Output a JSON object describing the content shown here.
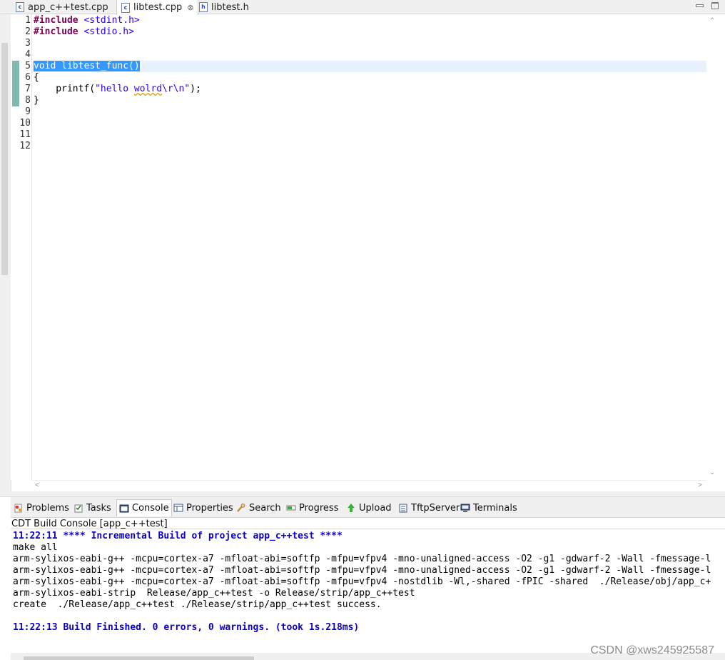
{
  "editor_tabs": [
    {
      "label": "app_c++test.cpp",
      "icon": "cpp-file-icon",
      "active": false
    },
    {
      "label": "libtest.cpp",
      "icon": "cpp-file-icon",
      "active": true,
      "close_glyph": "⊗"
    },
    {
      "label": "libtest.h",
      "icon": "header-file-icon",
      "active": false
    }
  ],
  "editor": {
    "line_numbers": [
      "1",
      "2",
      "3",
      "4",
      "5",
      "6",
      "7",
      "8",
      "9",
      "10",
      "11",
      "12"
    ],
    "lines": [
      {
        "n": 1,
        "kw": "#include",
        "rest": " <stdint.h>"
      },
      {
        "n": 2,
        "kw": "#include",
        "rest": " <stdio.h>"
      },
      {
        "n": 5,
        "selected": "void libtest_func()"
      },
      {
        "n": 6,
        "text": "{"
      },
      {
        "n": 7,
        "prefix": "    printf(",
        "str_a": "\"hello ",
        "str_b": "wolrd",
        "str_c": "\\r\\n\"",
        "suffix": ");"
      },
      {
        "n": 8,
        "text": "}"
      }
    ],
    "current_line": 5
  },
  "view_tabs": [
    {
      "label": "Problems",
      "icon": "problems-icon"
    },
    {
      "label": "Tasks",
      "icon": "tasks-icon"
    },
    {
      "label": "Console",
      "icon": "console-icon",
      "active": true
    },
    {
      "label": "Properties",
      "icon": "properties-icon"
    },
    {
      "label": "Search",
      "icon": "search-icon"
    },
    {
      "label": "Progress",
      "icon": "progress-icon"
    },
    {
      "label": "Upload",
      "icon": "upload-icon"
    },
    {
      "label": "TftpServer",
      "icon": "tftp-server-icon"
    },
    {
      "label": "Terminals",
      "icon": "terminals-icon"
    }
  ],
  "console": {
    "title": "CDT Build Console [app_c++test]",
    "lines": [
      {
        "text": "11:22:11 **** Incremental Build of project app_c++test ****",
        "style": "info"
      },
      {
        "text": "make all",
        "style": "normal"
      },
      {
        "text": "arm-sylixos-eabi-g++ -mcpu=cortex-a7 -mfloat-abi=softfp -mfpu=vfpv4 -mno-unaligned-access -O2 -g1 -gdwarf-2 -Wall -fmessage-l",
        "style": "normal"
      },
      {
        "text": "arm-sylixos-eabi-g++ -mcpu=cortex-a7 -mfloat-abi=softfp -mfpu=vfpv4 -mno-unaligned-access -O2 -g1 -gdwarf-2 -Wall -fmessage-l",
        "style": "normal"
      },
      {
        "text": "arm-sylixos-eabi-g++ -mcpu=cortex-a7 -mfloat-abi=softfp -mfpu=vfpv4 -nostdlib -Wl,-shared -fPIC -shared  ./Release/obj/app_c+",
        "style": "normal"
      },
      {
        "text": "arm-sylixos-eabi-strip  Release/app_c++test -o Release/strip/app_c++test",
        "style": "normal"
      },
      {
        "text": "create  ./Release/app_c++test ./Release/strip/app_c++test success.",
        "style": "normal"
      },
      {
        "text": "",
        "style": "normal"
      },
      {
        "text": "11:22:13 Build Finished. 0 errors, 0 warnings. (took 1s.218ms)",
        "style": "info"
      }
    ]
  },
  "watermark": "CSDN @xws245925587",
  "colors": {
    "keyword": "#7f0055",
    "string": "#2a00ff",
    "selection": "#3399ff",
    "current_line": "#e8f2fe",
    "console_info": "#0a00c8",
    "change_marker": "#7fb9b0"
  }
}
